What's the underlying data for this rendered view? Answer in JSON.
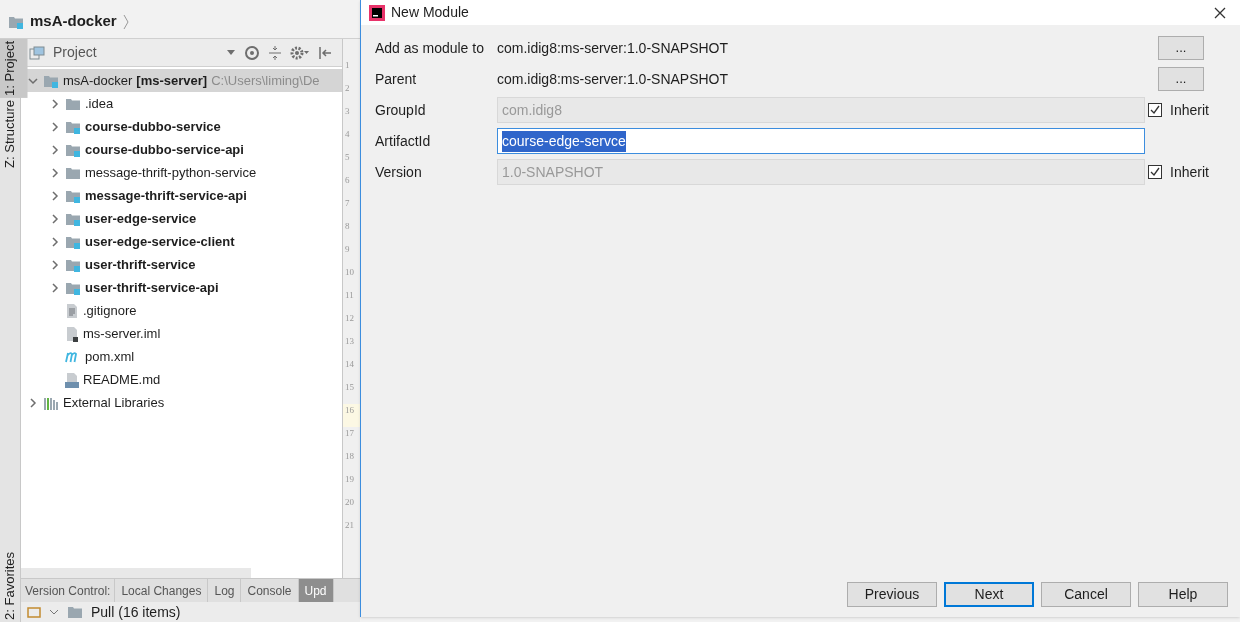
{
  "breadcrumb": {
    "label": "msA-docker"
  },
  "side_tabs": [
    {
      "label": "1: Project",
      "selected": true
    },
    {
      "label": "Z: Structure",
      "selected": false
    },
    {
      "label": "2: Favorites",
      "selected": false
    }
  ],
  "project_panel": {
    "title": "Project"
  },
  "tree": [
    {
      "label": "msA-docker",
      "module": "[ms-server]",
      "path": "C:\\Users\\liming\\De",
      "kind": "module",
      "expanded": true,
      "children": [
        {
          "label": ".idea",
          "kind": "folder",
          "expanded": false
        },
        {
          "label": "course-dubbo-service",
          "kind": "module",
          "expanded": false
        },
        {
          "label": "course-dubbo-service-api",
          "kind": "module",
          "expanded": false
        },
        {
          "label": "message-thrift-python-service",
          "kind": "folder",
          "expanded": false
        },
        {
          "label": "message-thrift-service-api",
          "kind": "module",
          "expanded": false
        },
        {
          "label": "user-edge-service",
          "kind": "module",
          "expanded": false
        },
        {
          "label": "user-edge-service-client",
          "kind": "module",
          "expanded": false
        },
        {
          "label": "user-thrift-service",
          "kind": "module",
          "expanded": false
        },
        {
          "label": "user-thrift-service-api",
          "kind": "module",
          "expanded": false
        },
        {
          "label": ".gitignore",
          "kind": "text"
        },
        {
          "label": "ms-server.iml",
          "kind": "iml"
        },
        {
          "label": "pom.xml",
          "kind": "maven"
        },
        {
          "label": "README.md",
          "kind": "markdown"
        }
      ]
    },
    {
      "label": "External Libraries",
      "kind": "libraries",
      "expanded": false
    }
  ],
  "gutter": [
    "1",
    "2",
    "3",
    "4",
    "5",
    "6",
    "7",
    "8",
    "9",
    "10",
    "11",
    "12",
    "13",
    "14",
    "15",
    "16",
    "17",
    "18",
    "19",
    "20",
    "21"
  ],
  "version_control": {
    "label": "Version Control:",
    "tabs": [
      {
        "label": "Local Changes",
        "selected": false
      },
      {
        "label": "Log",
        "selected": false
      },
      {
        "label": "Console",
        "selected": false
      },
      {
        "label": "Upd",
        "selected": true
      }
    ],
    "pull": "Pull (16 items)"
  },
  "dialog": {
    "title": "New Module",
    "rows": [
      {
        "kind": "text",
        "label": "Add as module to",
        "value": "com.idig8:ms-server:1.0-SNAPSHOT",
        "button": "..."
      },
      {
        "kind": "text",
        "label": "Parent",
        "value": "com.idig8:ms-server:1.0-SNAPSHOT",
        "button": "..."
      },
      {
        "kind": "field",
        "label": "GroupId",
        "value": "com.idig8",
        "disabled": true,
        "inherit": {
          "label": "Inherit",
          "checked": true
        }
      },
      {
        "kind": "field",
        "label": "ArtifactId",
        "value": "course-edge-servce",
        "disabled": false,
        "focused": true
      },
      {
        "kind": "field",
        "label": "Version",
        "value": "1.0-SNAPSHOT",
        "disabled": true,
        "inherit": {
          "label": "Inherit",
          "checked": true
        }
      }
    ],
    "buttons": [
      {
        "label": "Previous",
        "default": false
      },
      {
        "label": "Next",
        "default": true
      },
      {
        "label": "Cancel",
        "default": false
      },
      {
        "label": "Help",
        "default": false
      }
    ]
  }
}
